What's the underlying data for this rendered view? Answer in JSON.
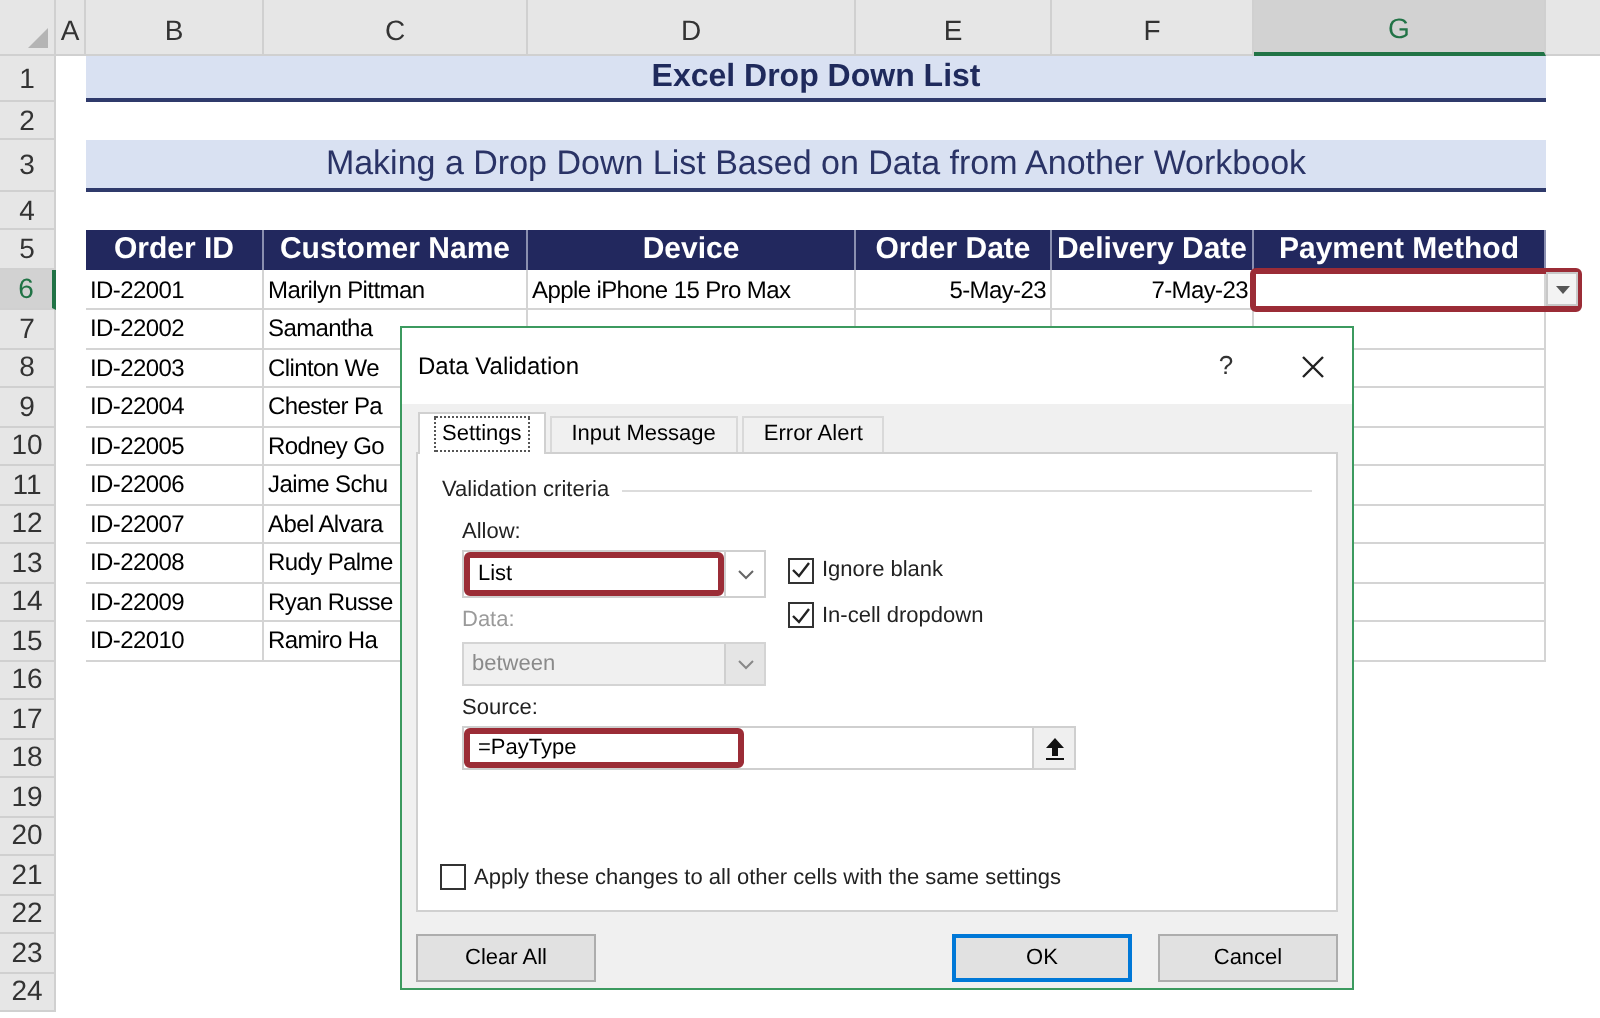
{
  "sheet": {
    "column_headers": [
      {
        "label": "A",
        "selected": false
      },
      {
        "label": "B",
        "selected": false
      },
      {
        "label": "C",
        "selected": false
      },
      {
        "label": "D",
        "selected": false
      },
      {
        "label": "E",
        "selected": false
      },
      {
        "label": "F",
        "selected": false
      },
      {
        "label": "G",
        "selected": true
      }
    ],
    "row_numbers": [
      {
        "label": "1",
        "selected": false
      },
      {
        "label": "2",
        "selected": false
      },
      {
        "label": "3",
        "selected": false
      },
      {
        "label": "4",
        "selected": false
      },
      {
        "label": "5",
        "selected": false
      },
      {
        "label": "6",
        "selected": true
      },
      {
        "label": "7",
        "selected": false
      },
      {
        "label": "8",
        "selected": false
      },
      {
        "label": "9",
        "selected": false
      },
      {
        "label": "10",
        "selected": false
      },
      {
        "label": "11",
        "selected": false
      },
      {
        "label": "12",
        "selected": false
      },
      {
        "label": "13",
        "selected": false
      },
      {
        "label": "14",
        "selected": false
      },
      {
        "label": "15",
        "selected": false
      },
      {
        "label": "16",
        "selected": false
      },
      {
        "label": "17",
        "selected": false
      },
      {
        "label": "18",
        "selected": false
      },
      {
        "label": "19",
        "selected": false
      },
      {
        "label": "20",
        "selected": false
      },
      {
        "label": "21",
        "selected": false
      },
      {
        "label": "22",
        "selected": false
      },
      {
        "label": "23",
        "selected": false
      },
      {
        "label": "24",
        "selected": false
      }
    ],
    "title": "Excel Drop Down List",
    "subtitle": "Making a Drop Down List Based on Data from Another Workbook",
    "table": {
      "columns": [
        {
          "label": "Order ID",
          "kind": "text"
        },
        {
          "label": "Customer Name",
          "kind": "text"
        },
        {
          "label": "Device",
          "kind": "text"
        },
        {
          "label": "Order Date",
          "kind": "date"
        },
        {
          "label": "Delivery Date",
          "kind": "date"
        },
        {
          "label": "Payment Method",
          "kind": "text"
        }
      ],
      "rows": [
        {
          "cells": [
            "ID-22001",
            "Marilyn Pittman",
            "Apple iPhone 15 Pro Max",
            "5-May-23",
            "7-May-23",
            ""
          ],
          "active_cell_highlighted": true
        },
        {
          "cells": [
            "ID-22002",
            "Samantha"
          ]
        },
        {
          "cells": [
            "ID-22003",
            "Clinton We"
          ]
        },
        {
          "cells": [
            "ID-22004",
            "Chester Pa"
          ]
        },
        {
          "cells": [
            "ID-22005",
            "Rodney Go"
          ]
        },
        {
          "cells": [
            "ID-22006",
            "Jaime Schu"
          ]
        },
        {
          "cells": [
            "ID-22007",
            "Abel Alvara"
          ]
        },
        {
          "cells": [
            "ID-22008",
            "Rudy Palme"
          ]
        },
        {
          "cells": [
            "ID-22009",
            "Ryan Russe"
          ]
        },
        {
          "cells": [
            "ID-22010",
            "Ramiro Ha"
          ]
        }
      ]
    }
  },
  "dialog": {
    "title": "Data Validation",
    "help": "?",
    "tabs": [
      {
        "label": "Settings",
        "selected": true
      },
      {
        "label": "Input Message",
        "selected": false
      },
      {
        "label": "Error Alert",
        "selected": false
      }
    ],
    "group_label": "Validation criteria",
    "allow": {
      "label": "Allow:",
      "value": "List",
      "highlighted": true
    },
    "data": {
      "label": "Data:",
      "value": "between",
      "disabled": true
    },
    "checkboxes": [
      {
        "label": "Ignore blank",
        "checked": true
      },
      {
        "label": "In-cell dropdown",
        "checked": true
      }
    ],
    "source": {
      "label": "Source:",
      "value": "=PayType",
      "highlighted": true
    },
    "apply": {
      "label": "Apply these changes to all other cells with the same settings",
      "checked": false
    },
    "buttons": [
      {
        "label": "Clear All",
        "default": false
      },
      {
        "label": "OK",
        "default": true
      },
      {
        "label": "Cancel",
        "default": false
      }
    ]
  }
}
